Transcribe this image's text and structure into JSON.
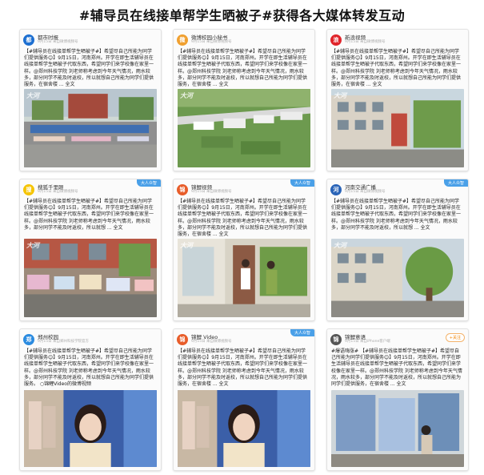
{
  "page_title": "#辅导员在线接单帮学生晒被子#获得各大媒体转发互动",
  "cards": [
    {
      "account": "都市时报",
      "meta": "9月15日 来自微博视频号",
      "text": "【#辅导员在线接单帮学生晒被子#】希望尽自己所能为同学们提供服务😊】9月15日，河南郑州。开学在即生活辅导员在线接单帮学生晒被子代取东西，希望同学们来学校像在家里一样。@郑州科技学院 刘老师称考虑到今年天气情况，雨水较多，部分同学不能及时返校，所以就想自己所能为同学们提供服务，在宿舍楼 ... 全文",
      "icon": "news-avatar"
    },
    {
      "account": "微博校园小秘书",
      "meta": "9月15日 来自微博视频号",
      "text": "【#辅导员在线接单帮学生晒被子#】希望尽自己所能为同学们提供服务😊】9月15日，河南郑州。开学在即生活辅导员在线接单帮学生晒被子代取东西，希望同学们来学校像在家里一样。@郑州科技学院 刘老师称考虑到今年天气情况，雨水较多，部分同学不能及时返校，所以就想自己所能为同学们提供服务，在宿舍楼 ... 全文",
      "icon": "campus-avatar"
    },
    {
      "account": "新浪视频",
      "meta": "9月15日 来自微博视频号",
      "text": "【#辅导员在线接单帮学生晒被子#】希望尽自己所能为同学们提供服务😊】9月15日，河南郑州。开学在即生活辅导员在线接单帮学生晒被子代取东西，希望同学们来学校像在家里一样。@郑州科技学院 刘老师称考虑到今年天气情况，雨水较多，部分同学不能及时返校，所以就想自己所能为同学们提供服务，在宿舍楼 ... 全文",
      "icon": "sina-avatar"
    },
    {
      "account": "搜狐千里眼",
      "meta": "9月15日 来自微博视频号",
      "text": "【#辅导员在线接单帮学生晒被子#】希望尽自己所能为同学们提供服务😊】9月15日，河南郑州。开学在即生活辅导员在线接单帮学生晒被子代取东西，希望同学们来学校像在家里一样。@郑州科技学院 刘老师称考虑到今年天气情况，雨水较多，部分同学不能及时返校，所以就想 ... 全文",
      "icon": "sohu-avatar",
      "badge": "大人众智"
    },
    {
      "account": "锦鲤视频",
      "meta": "9月15日 来自微博视频号",
      "text": "【#辅导员在线接单帮学生晒被子#】希望尽自己所能为同学们提供服务😊】9月15日，河南郑州。开学在即生活辅导员在线接单帮学生晒被子代取东西，希望同学们来学校像在家里一样。@郑州科技学院 刘老师称考虑到今年天气情况，雨水较多，部分同学不能及时返校，所以就想自己所能为同学们提供服务，在宿舍楼 ... 全文",
      "icon": "video-avatar",
      "badge": "大人众智"
    },
    {
      "account": "河南交通广播",
      "meta": "9月15日 来自微博视频号",
      "text": "【#辅导员在线接单帮学生晒被子#】希望尽自己所能为同学们提供服务😊】9月15日，河南郑州。开学在即生活辅导员在线接单帮学生晒被子代取东西，希望同学们来学校像在家里一样。@郑州科技学院 刘老师称考虑到今年天气情况，雨水较多，部分同学不能及时返校，所以就想 ... 全文",
      "icon": "radio-avatar",
      "badge": "大人众智"
    },
    {
      "account": "郑州校园",
      "meta": "9月15日 来自郑州科技学院官方",
      "text": "【#辅导员在线接单帮学生晒被子#】希望尽自己所能为同学们提供服务😊】9月15日，河南郑州。开学在即生活辅导员在线接单帮学生晒被子代取东西，希望同学们来学校像在家里一样。@郑州科技学院 刘老师称考虑到今年天气情况，雨水较多，部分同学不能及时返校，所以就想自己所能为同学们提供服务。 ○锦鲤Video的微博视频",
      "icon": "school-avatar"
    },
    {
      "account": "锦鲤 Video",
      "meta": "9月15日 来自微博视频号",
      "text": "【#辅导员在线接单帮学生晒被子#】希望尽自己所能为同学们提供服务😊】9月15日，河南郑州。开学在即生活辅导员在线接单帮学生晒被子代取东西，希望同学们来学校像在家里一样。@郑州科技学院 刘老师称考虑到今年天气情况，雨水较多，部分同学不能及时返校，所以就想自己所能为同学们提供服务，在宿舍楼 ... 全文",
      "icon": "video-avatar",
      "badge": "大人众智"
    },
    {
      "account": "锦鲤意语",
      "meta": "9月15日 来自iPhone客户端",
      "text": "#爆语嗨涨# 【#辅导员在线接单帮学生晒被子#】希望尽自己所能为同学们提供服务😊】9月15日，河南郑州。开学在即生活辅导员在线接单帮学生晒被子代取东西，希望同学们来学校像在家里一样。@郑州科技学院 刘老师称考虑到今年天气情况，雨水较多，部分同学不能及时返校，所以就想自己所能为同学们提供服务，在宿舍楼 ... 全文",
      "icon": "quote-avatar"
    }
  ],
  "ui": {
    "follow_label": "+关注",
    "logo_text": "大河"
  },
  "colors": {
    "link": "#3a6fb5",
    "follow": "#f08300",
    "badge": "#4aa0e8"
  }
}
